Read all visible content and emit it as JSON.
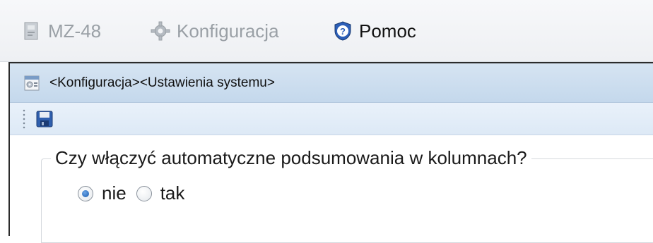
{
  "menu": {
    "items": [
      {
        "label": "MZ-48",
        "icon": "app-icon",
        "active": false
      },
      {
        "label": "Konfiguracja",
        "icon": "gear-icon",
        "active": false
      },
      {
        "label": "Pomoc",
        "icon": "help-shield-icon",
        "active": true
      }
    ]
  },
  "window": {
    "title": "<Konfiguracja><Ustawienia systemu>",
    "title_icon": "settings-window-icon"
  },
  "toolbar": {
    "save_icon": "floppy-disk-icon"
  },
  "settings": {
    "question": "Czy włączyć automatyczne podsumowania w kolumnach?",
    "options": [
      {
        "label": "nie",
        "checked": true
      },
      {
        "label": "tak",
        "checked": false
      }
    ]
  },
  "colors": {
    "titlebar": "#c4d8ec",
    "toolbar": "#dde9f6",
    "radio_selected": "#1a5cb0"
  }
}
